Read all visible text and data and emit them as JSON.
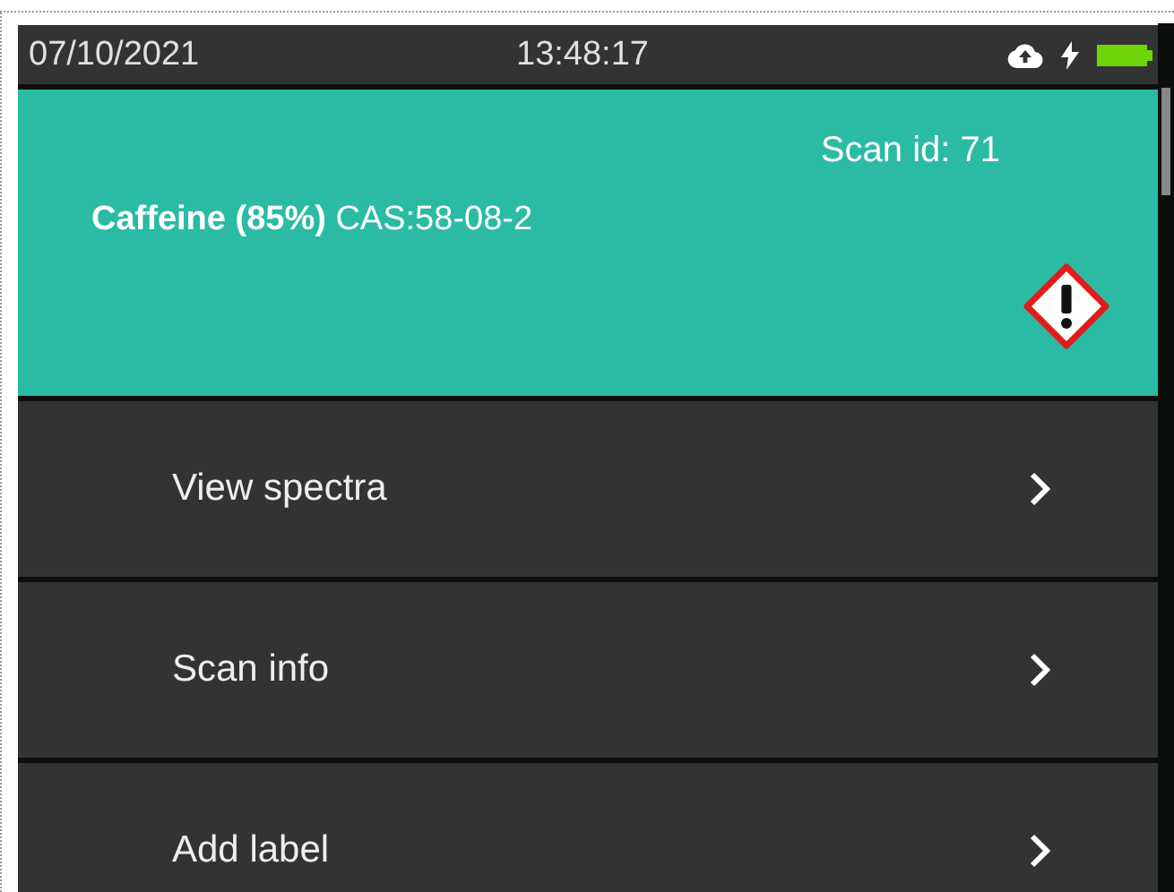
{
  "status_bar": {
    "date": "07/10/2021",
    "time": "13:48:17"
  },
  "result": {
    "scan_id": "Scan id: 71",
    "compound": "Caffeine (85%)",
    "cas": "CAS:58-08-2",
    "hazard": true
  },
  "menu": [
    {
      "label": "View spectra"
    },
    {
      "label": "Scan info"
    },
    {
      "label": "Add label"
    }
  ]
}
